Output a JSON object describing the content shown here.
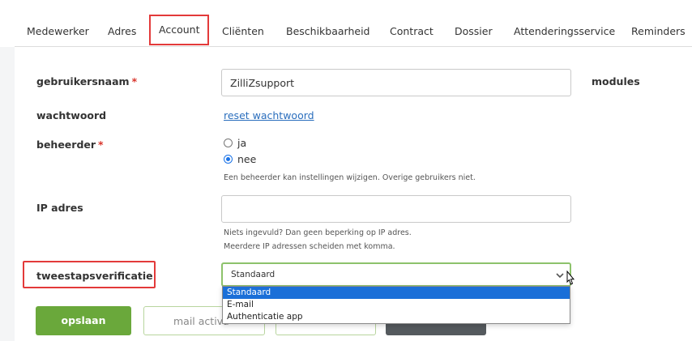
{
  "tabs": [
    {
      "label": "Medewerker"
    },
    {
      "label": "Adres"
    },
    {
      "label": "Account"
    },
    {
      "label": "Cliënten"
    },
    {
      "label": "Beschikbaarheid"
    },
    {
      "label": "Contract"
    },
    {
      "label": "Dossier"
    },
    {
      "label": "Attenderingsservice"
    },
    {
      "label": "Reminders"
    }
  ],
  "active_tab": "Account",
  "form": {
    "username": {
      "label": "gebruikersnaam",
      "required_mark": "*",
      "value": "ZilliZsupport"
    },
    "modules_label": "modules",
    "password": {
      "label": "wachtwoord",
      "link": "reset wachtwoord"
    },
    "admin": {
      "label": "beheerder",
      "required_mark": "*",
      "options": [
        "ja",
        "nee"
      ],
      "selected": "nee",
      "help": "Een beheerder kan instellingen wijzigen. Overige gebruikers niet."
    },
    "ip": {
      "label": "IP adres",
      "value": "",
      "help_1": "Niets ingevuld? Dan geen beperking op IP adres.",
      "help_2": "Meerdere IP adressen scheiden met komma."
    },
    "twofa": {
      "label": "tweestapsverificatie",
      "selected": "Standaard",
      "options": [
        "Standaard",
        "E-mail",
        "Authenticatie app"
      ]
    }
  },
  "buttons": {
    "save": "opslaan",
    "mail": "mail activa"
  },
  "colors": {
    "highlight": "#e33a3a",
    "primary_green": "#6aa83b",
    "select_focus": "#8dc26b",
    "option_selected": "#1a6fd8",
    "link": "#2a6ebd"
  }
}
